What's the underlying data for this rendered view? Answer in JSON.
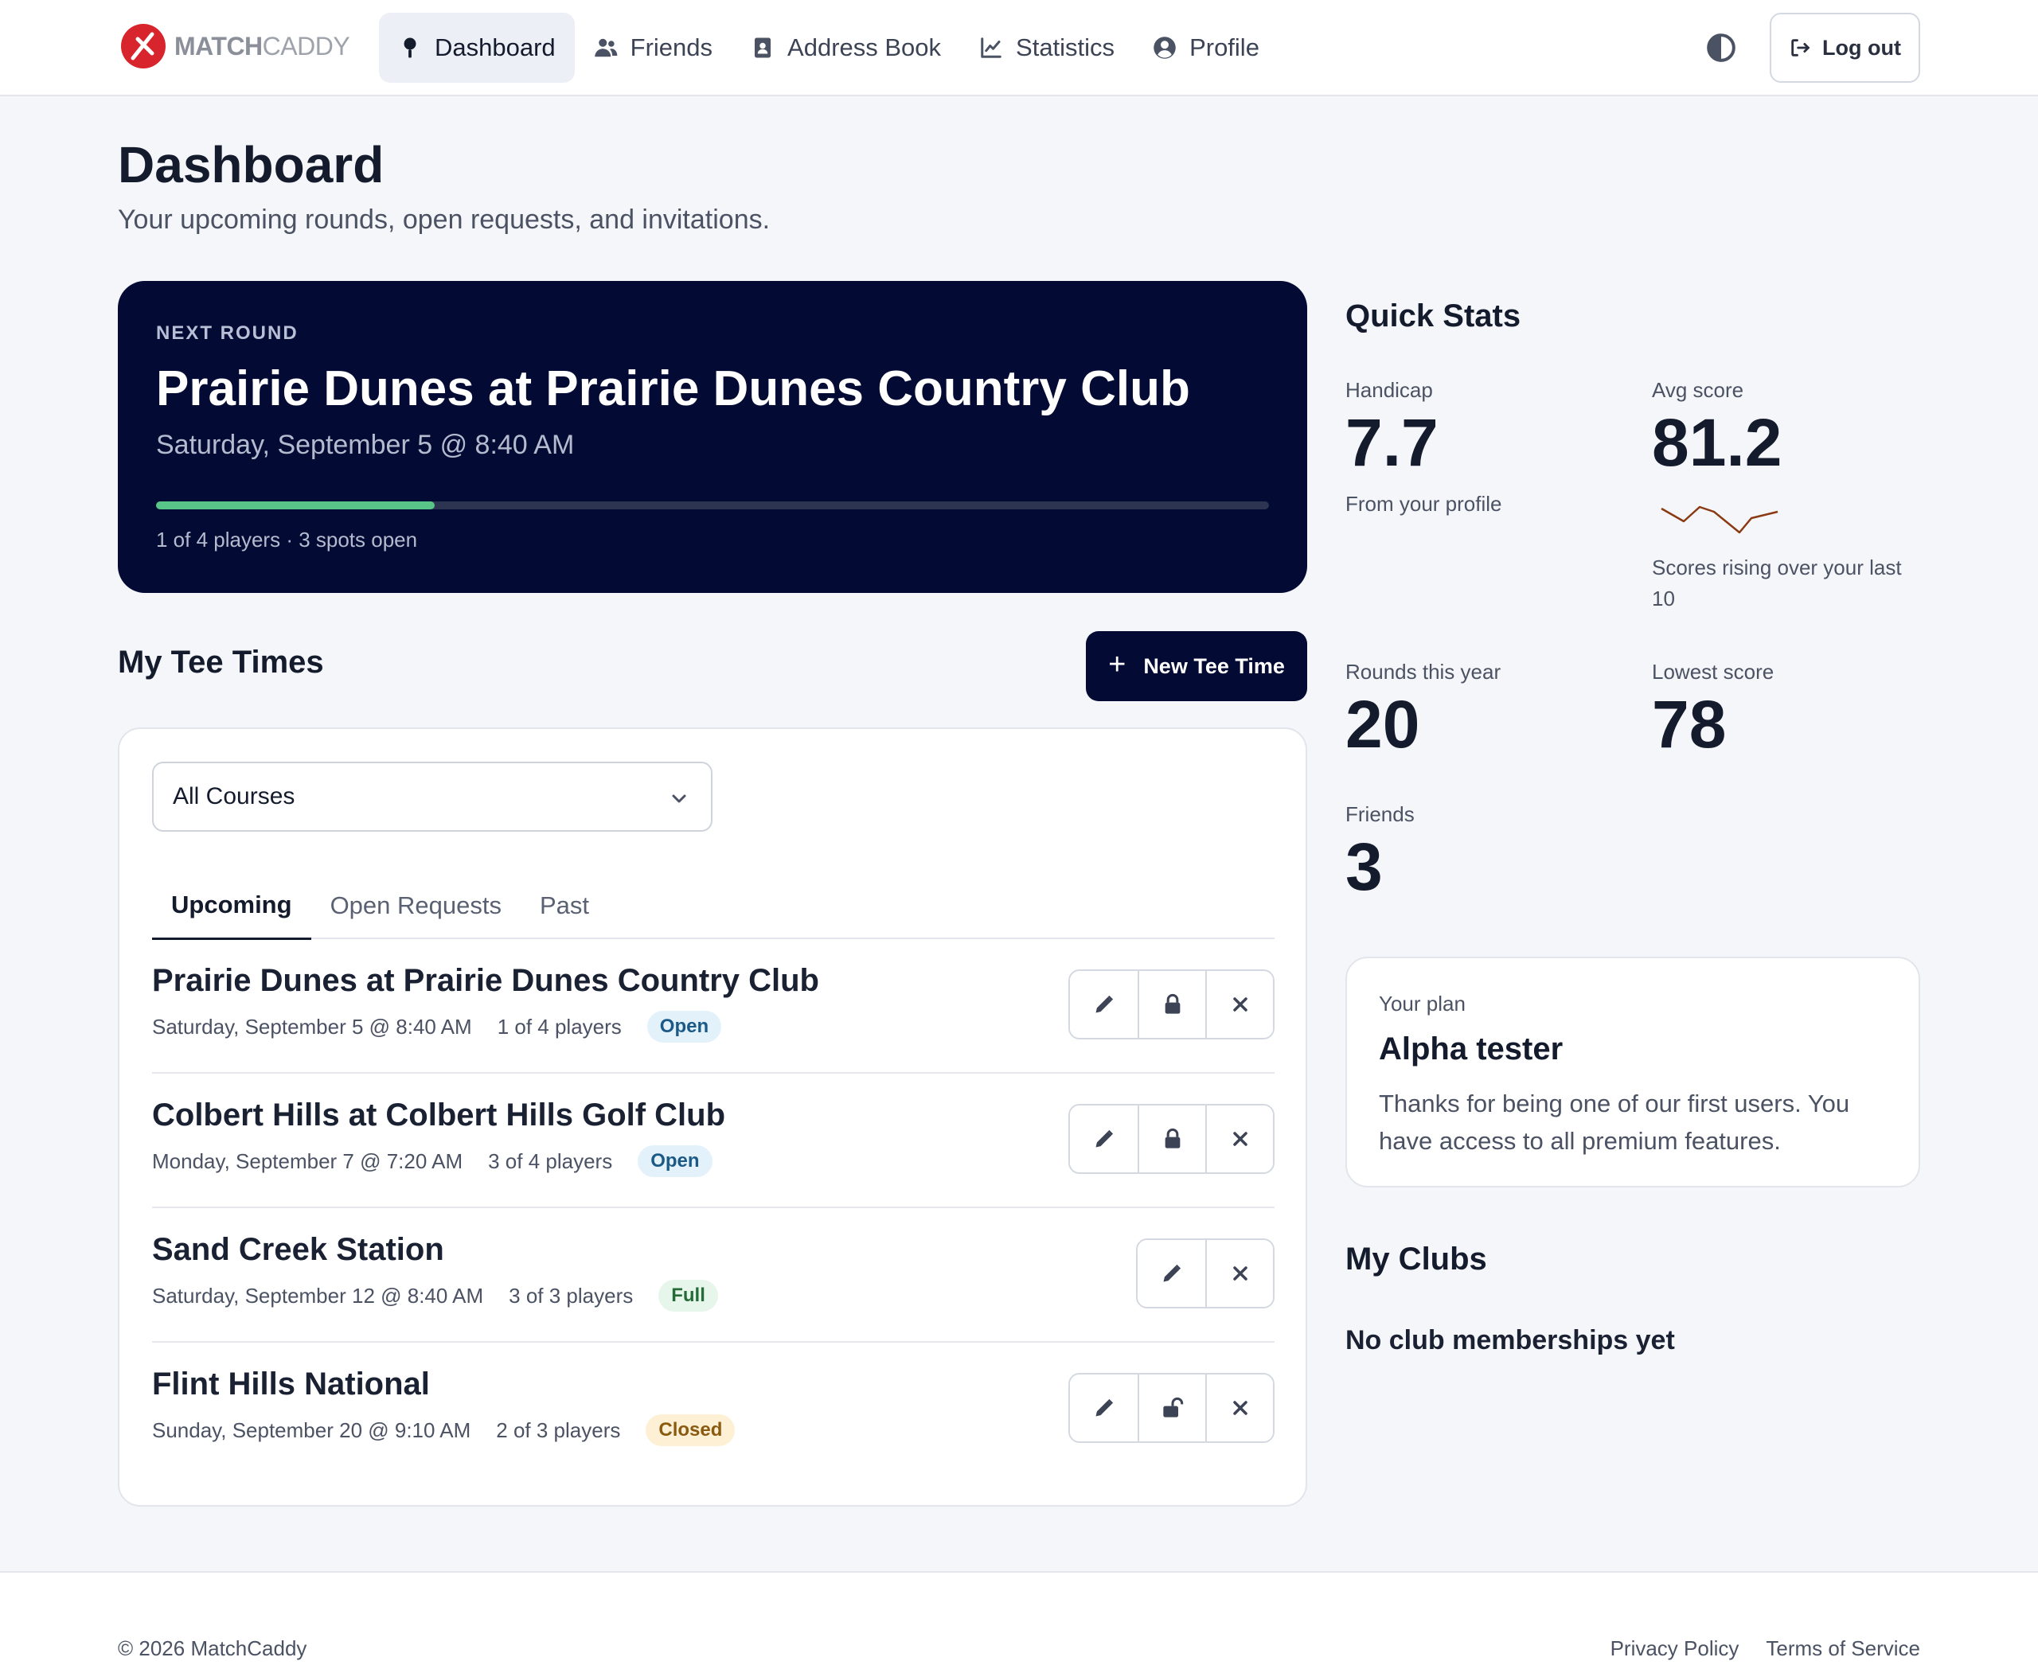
{
  "brand": {
    "name_part1": "MATCH",
    "name_part2": "CADDY",
    "logo_icon": "golf-flag-logo-icon",
    "accent": "#d8242c"
  },
  "nav": {
    "items": [
      {
        "label": "Dashboard",
        "icon": "golf-ball-tee-icon",
        "active": true
      },
      {
        "label": "Friends",
        "icon": "users-icon",
        "active": false
      },
      {
        "label": "Address Book",
        "icon": "address-book-icon",
        "active": false
      },
      {
        "label": "Statistics",
        "icon": "chart-line-icon",
        "active": false
      },
      {
        "label": "Profile",
        "icon": "user-circle-icon",
        "active": false
      }
    ],
    "theme_icon": "contrast-icon",
    "logout_label": "Log out"
  },
  "page": {
    "title": "Dashboard",
    "subtitle": "Your upcoming rounds, open requests, and invitations."
  },
  "next_round": {
    "eyebrow": "NEXT ROUND",
    "title": "Prairie Dunes at Prairie Dunes Country Club",
    "date": "Saturday, September 5 @ 8:40 AM",
    "progress_fraction": 0.25,
    "players_text": "1 of 4 players · 3 spots open"
  },
  "tee_times": {
    "heading": "My Tee Times",
    "new_button_label": "New Tee Time",
    "course_filter": "All Courses",
    "tabs": [
      {
        "label": "Upcoming",
        "active": true
      },
      {
        "label": "Open Requests",
        "active": false
      },
      {
        "label": "Past",
        "active": false
      }
    ],
    "rows": [
      {
        "name": "Prairie Dunes at Prairie Dunes Country Club",
        "date": "Saturday, September 5 @ 8:40 AM",
        "players": "1 of 4 players",
        "status": "Open",
        "status_kind": "open",
        "lock": "locked"
      },
      {
        "name": "Colbert Hills at Colbert Hills Golf Club",
        "date": "Monday, September 7 @ 7:20 AM",
        "players": "3 of 4 players",
        "status": "Open",
        "status_kind": "open",
        "lock": "locked"
      },
      {
        "name": "Sand Creek Station",
        "date": "Saturday, September 12 @ 8:40 AM",
        "players": "3 of 3 players",
        "status": "Full",
        "status_kind": "full",
        "lock": "none"
      },
      {
        "name": "Flint Hills National",
        "date": "Sunday, September 20 @ 9:10 AM",
        "players": "2 of 3 players",
        "status": "Closed",
        "status_kind": "closed",
        "lock": "unlocked"
      }
    ]
  },
  "quick_stats": {
    "heading": "Quick Stats",
    "handicap": {
      "label": "Handicap",
      "value": "7.7",
      "note": "From your profile"
    },
    "avg_score": {
      "label": "Avg score",
      "value": "81.2",
      "note": "Scores rising over your last 10",
      "trend_color": "#8a3a12"
    },
    "rounds": {
      "label": "Rounds this year",
      "value": "20"
    },
    "lowest": {
      "label": "Lowest score",
      "value": "78"
    },
    "friends": {
      "label": "Friends",
      "value": "3"
    }
  },
  "plan": {
    "label": "Your plan",
    "name": "Alpha tester",
    "description": "Thanks for being one of our first users. You have access to all premium features."
  },
  "clubs": {
    "heading": "My Clubs",
    "empty_text": "No club memberships yet"
  },
  "footer": {
    "copyright": "© 2026 MatchCaddy",
    "links": [
      "Privacy Policy",
      "Terms of Service"
    ]
  }
}
